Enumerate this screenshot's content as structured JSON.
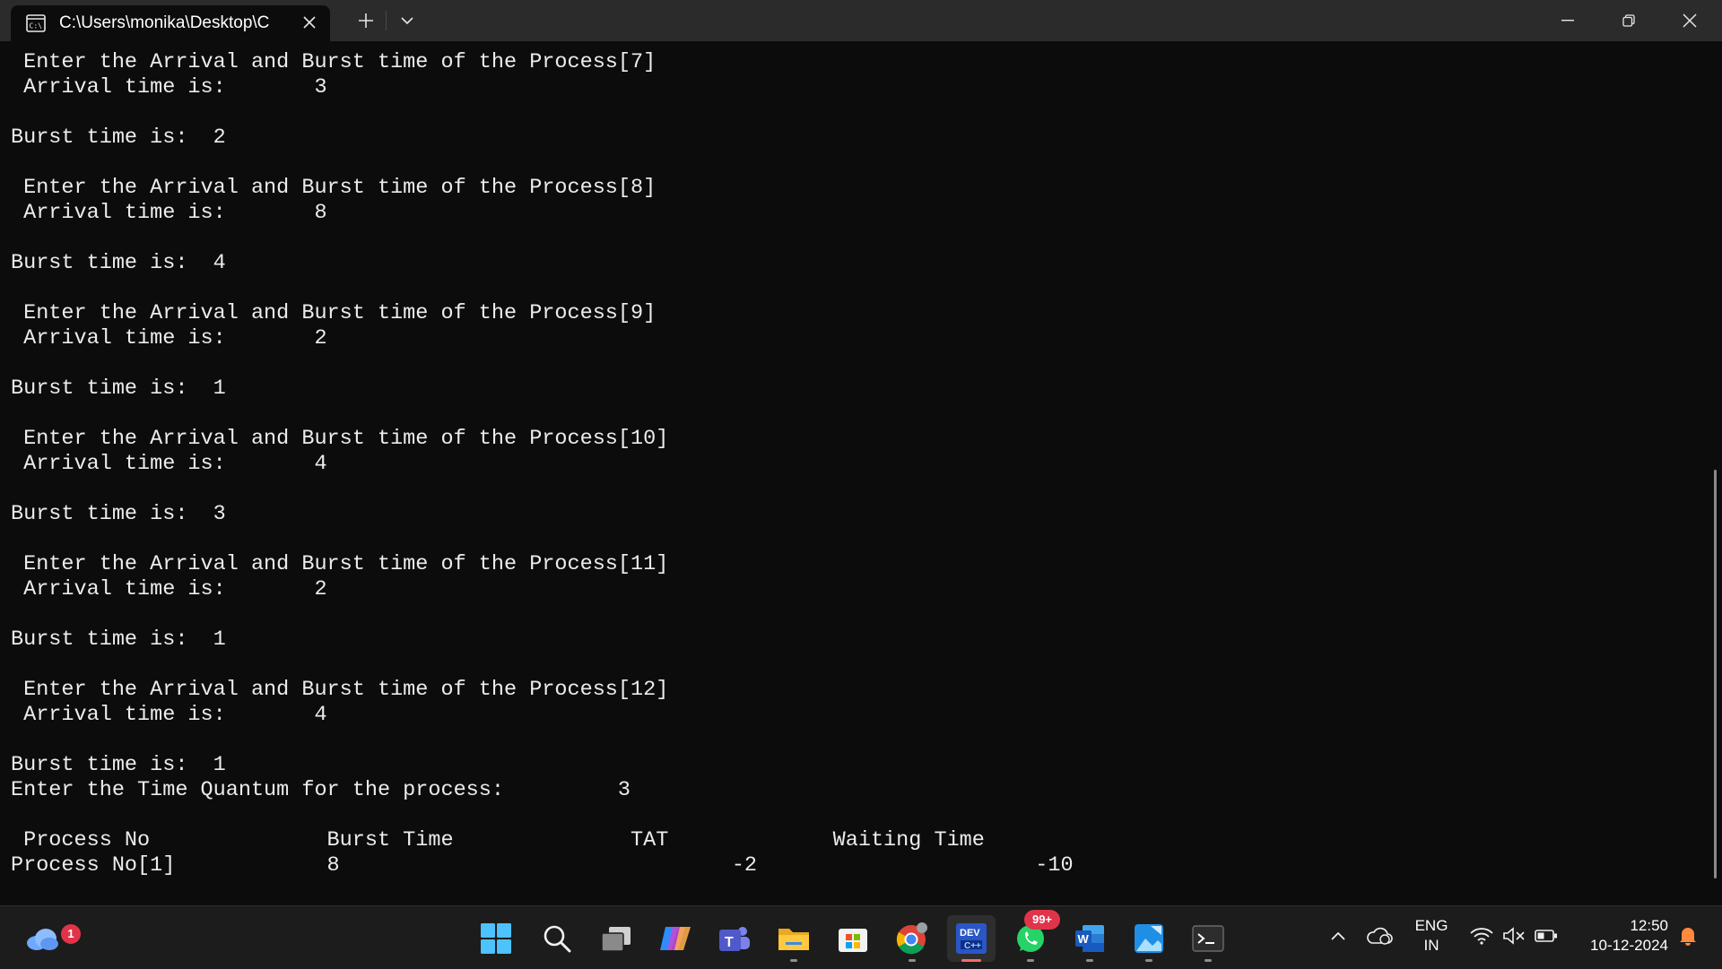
{
  "window": {
    "tab_title": "C:\\Users\\monika\\Desktop\\C",
    "tab_icon": "terminal-icon",
    "controls": [
      "new-tab",
      "tab-dropdown",
      "minimize",
      "restore",
      "close"
    ]
  },
  "console": {
    "lines": [
      " Enter the Arrival and Burst time of the Process[7]",
      " Arrival time is:       3",
      "",
      "Burst time is:  2",
      "",
      " Enter the Arrival and Burst time of the Process[8]",
      " Arrival time is:       8",
      "",
      "Burst time is:  4",
      "",
      " Enter the Arrival and Burst time of the Process[9]",
      " Arrival time is:       2",
      "",
      "Burst time is:  1",
      "",
      " Enter the Arrival and Burst time of the Process[10]",
      " Arrival time is:       4",
      "",
      "Burst time is:  3",
      "",
      " Enter the Arrival and Burst time of the Process[11]",
      " Arrival time is:       2",
      "",
      "Burst time is:  1",
      "",
      " Enter the Arrival and Burst time of the Process[12]",
      " Arrival time is:       4",
      "",
      "Burst time is:  1",
      "Enter the Time Quantum for the process:         3",
      "",
      " Process No              Burst Time              TAT             Waiting Time",
      "Process No[1]            8                               -2                      -10"
    ]
  },
  "taskbar": {
    "weather_badge": "1",
    "whatsapp_badge": "99+",
    "apps": [
      "start-icon",
      "search-icon",
      "task-view-icon",
      "copilot-icon",
      "teams-icon",
      "file-explorer-icon",
      "store-icon",
      "chrome-icon",
      "dev-cpp-icon",
      "whatsapp-icon",
      "word-icon",
      "photos-icon",
      "terminal-icon"
    ],
    "active_app": "dev-cpp-icon"
  },
  "tray": {
    "lang_line1": "ENG",
    "lang_line2": "IN",
    "time": "12:50",
    "date": "10-12-2024",
    "icons": [
      "chevron-up-icon",
      "onedrive-icon",
      "wifi-icon",
      "volume-muted-icon",
      "battery-icon",
      "notification-bell-icon"
    ]
  },
  "colors": {
    "console_bg": "#0c0c0c",
    "console_text": "#ececec",
    "titlebar_bg": "#2b2b2b",
    "taskbar_bg": "#1c1c1c",
    "badge": "#e0344a",
    "active_indicator": "#ff6b6b"
  }
}
